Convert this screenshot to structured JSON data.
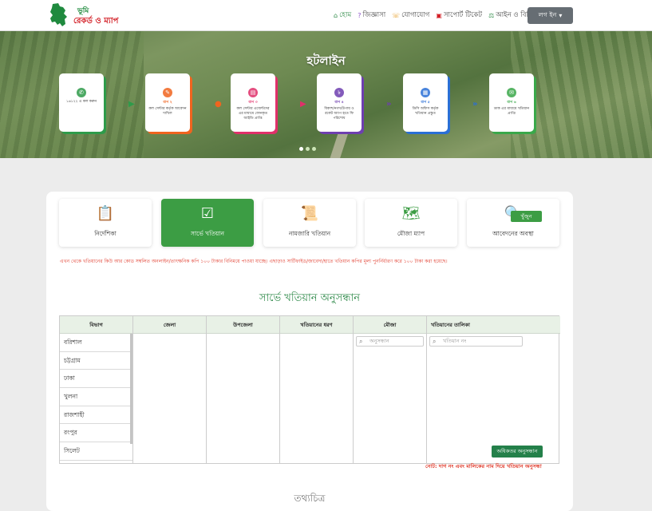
{
  "header": {
    "logo_line1": "ভূমি",
    "logo_line2": "রেকর্ড ও ম্যাপ",
    "nav": [
      {
        "label": "হোম",
        "icon": "home-icon",
        "active": true
      },
      {
        "label": "জিজ্ঞাসা",
        "icon": "question-icon",
        "active": false
      },
      {
        "label": "যোগাযোগ",
        "icon": "phone-icon",
        "active": false
      },
      {
        "label": "সাপোর্ট টিকেট",
        "icon": "ticket-icon",
        "active": false
      },
      {
        "label": "আইন ও বিধি",
        "icon": "law-icon",
        "active": false
      }
    ],
    "login_label": "লগ ইন"
  },
  "banner": {
    "title": "হটলাইন",
    "steps": [
      {
        "tag": "",
        "text": "১৬১২২ এ কল করুন",
        "color": "#2e9b4a"
      },
      {
        "tag": "ধাপ ২",
        "text": "কল সেন্টার কর্তৃক আবেদন দাখিল",
        "color": "#f0641f"
      },
      {
        "tag": "ধাপ ৩",
        "text": "কল সেন্টার এজেন্টদের এর মাধ্যমে ফোনকৃত আইডি প্রাপ্তি",
        "color": "#e0306a"
      },
      {
        "tag": "ধাপ ৪",
        "text": "বিকাশ/নগদ/উপায় ও রকেট অ্যাপ হতে ফি পরিশোধ",
        "color": "#6e3fb0"
      },
      {
        "tag": "ধাপ ৫",
        "text": "ডিসি অফিস কর্তৃক খতিয়ান প্রস্তুত",
        "color": "#2a6fd6"
      },
      {
        "tag": "ধাপ ৬",
        "text": "ডাক এর মাধ্যমে খতিয়ান প্রাপ্তি",
        "color": "#3aa84a"
      }
    ]
  },
  "cards": [
    {
      "label": "নির্দেশিকা",
      "icon": "guide-icon",
      "active": false
    },
    {
      "label": "সার্ভে খতিয়ান",
      "icon": "survey-khatian-icon",
      "active": true
    },
    {
      "label": "নামজারি খতিয়ান",
      "icon": "mutation-khatian-icon",
      "active": false
    },
    {
      "label": "মৌজা ম্যাপ",
      "icon": "mouza-map-icon",
      "active": false
    },
    {
      "label": "আবেদনের অবস্থা",
      "icon": "application-status-icon",
      "active": false
    }
  ],
  "notice": "এখন থেকে খতিয়ানের কিউ আর কোড সম্বলিত অনলাইন/তাৎক্ষনিক কপি ১০০ টাকার বিনিময়ে পাওয়া যাচ্ছে। এছাড়াও সার্টিফাইড/জাবেদা/হাতে খতিয়ান কপির মূল্য পুনর্নির্ধারণ করে ১০০ টাকা করা হয়েছে।",
  "search_section": {
    "title": "সার্ভে খতিয়ান অনুসন্ধান",
    "columns": [
      "বিভাগ",
      "জেলা",
      "উপজেলা",
      "খতিয়ানের ধরণ",
      "মৌজা",
      "খতিয়ানের তালিকা"
    ],
    "divisions": [
      "বরিশাল",
      "চট্টগ্রাম",
      "ঢাকা",
      "খুলনা",
      "রাজশাহী",
      "রংপুর",
      "সিলেট"
    ],
    "mouza_placeholder": "অনুসন্ধান",
    "khatian_placeholder": "খতিয়ান নং",
    "find_label": "খুঁজুন",
    "advanced_label": "অধিকতর অনুসন্ধান",
    "note": "নোট: দাগ নং এবং মালিকের নাম দিয়ে খতিয়ান অনুসন্ধা"
  },
  "info_title": "তথ্যচিত্র"
}
